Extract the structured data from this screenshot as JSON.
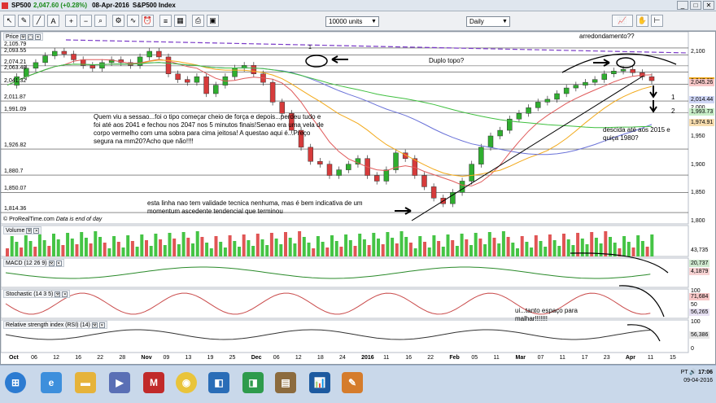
{
  "titlebar": {
    "symbol": "SP500",
    "change": "2,047.60 (+0.28%)",
    "date": "08-Apr-2016",
    "index": "S&P500 Index"
  },
  "toolbar": {
    "units": "10000 units",
    "period": "Daily"
  },
  "price_panel": {
    "label": "Price",
    "source": "© ProRealTime.com",
    "note": "Data is end of day",
    "left_levels": [
      "2,105.79",
      "2,093.55",
      "2,074.21",
      "2,063.48",
      "2,041.32",
      "2,011.87",
      "1,991.09",
      "1,926.82",
      "1,880.7",
      "1,850.07",
      "1,814.36"
    ],
    "right_axis": [
      "2,100",
      "2,050",
      "2,000",
      "1,950",
      "1,900",
      "1,850",
      "1,800"
    ],
    "right_tags": [
      {
        "text": "2,047.60",
        "color": "#f2a91a"
      },
      {
        "text": "2,045.26",
        "color": "#f7c7c7"
      },
      {
        "text": "2,014.44",
        "color": "#cfd6f5"
      },
      {
        "text": "2,000",
        "color": "#ffffff"
      },
      {
        "text": "1,993.73",
        "color": "#c9efc9"
      },
      {
        "text": "1,974.91",
        "color": "#f6dcae"
      }
    ]
  },
  "annotations": {
    "rounding": "arredondamento??",
    "double_top": "Duplo topo?",
    "one_a": "1",
    "one_b": "1",
    "two": "2",
    "session": "Quem viu a sessao...foi o tipo começar cheio de força e depois...perdeu tudo e foi até aos 2041 e fechou nos 2047 nos 5 minutos finais!Senao era uma vela de corpo vermelho com uma sobra para cima jeitosa! A questao aqui é...Preço segura na mm20?Acho que não!!!!",
    "trendline": "esta linha nao tem validade tecnica nenhuma, mas é bem indicativa de um momentum ascedente tendencial que terminou",
    "descent": "descida até aos 2015 e quiça 1980?",
    "room": "ui...tanto espaço para malhar!!!!!!!"
  },
  "volume_panel": {
    "label": "Volume",
    "tag": "43,735"
  },
  "macd_panel": {
    "label": "MACD (12 26 9)",
    "tags": [
      "20,737",
      "4,1879"
    ]
  },
  "stoch_panel": {
    "label": "Stochastic (14 3 5)",
    "tags": [
      "71,684",
      "56,265"
    ],
    "axis": [
      "100",
      "50",
      "0"
    ]
  },
  "rsi_panel": {
    "label": "Relative strength index (RSI) (14)",
    "tag": "56,386",
    "axis": [
      "100",
      "0"
    ]
  },
  "x_axis": [
    "Oct",
    "06",
    "12",
    "16",
    "22",
    "28",
    "Nov",
    "09",
    "13",
    "19",
    "25",
    "Dec",
    "06",
    "12",
    "18",
    "24",
    "2016",
    "11",
    "16",
    "22",
    "Feb",
    "05",
    "11",
    "Mar",
    "07",
    "11",
    "17",
    "23",
    "Apr",
    "11",
    "15"
  ],
  "tray": {
    "lang": "PT",
    "time": "17:06",
    "date": "09-04-2016"
  },
  "taskbar_apps": [
    "start",
    "ie",
    "folder",
    "media",
    "mcafee",
    "chrome",
    "app-blue",
    "app-green",
    "files",
    "prorealtime",
    "paint"
  ]
}
